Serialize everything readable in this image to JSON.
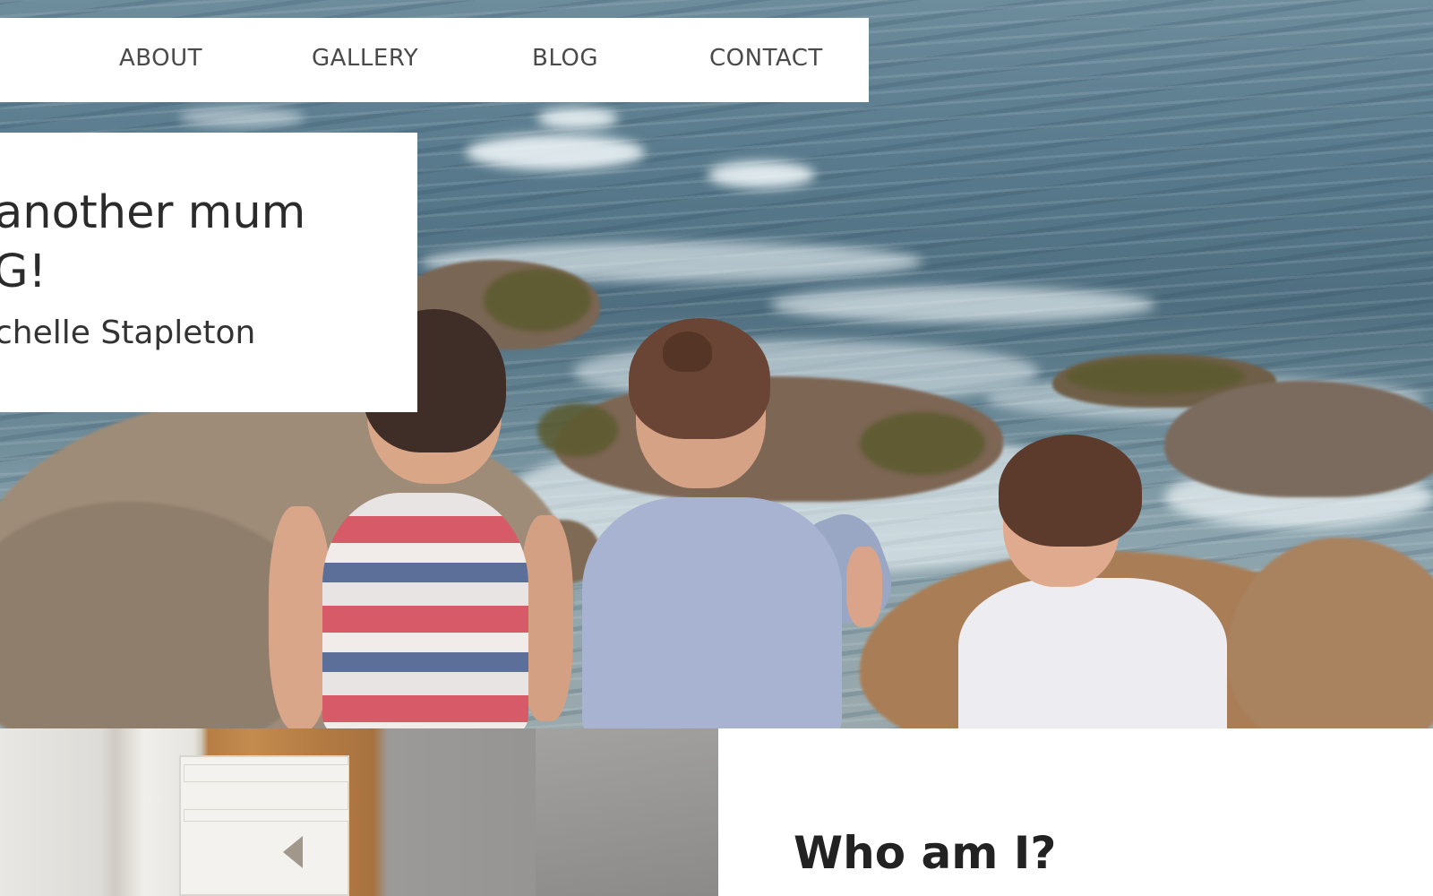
{
  "nav": {
    "items": [
      {
        "label": "ABOUT"
      },
      {
        "label": "GALLERY"
      },
      {
        "label": "BLOG"
      },
      {
        "label": "CONTACT"
      }
    ]
  },
  "hero": {
    "title_line_1": "another mum",
    "title_line_2": "G!",
    "subtitle": "chelle Stapleton"
  },
  "about": {
    "heading": "Who am I?"
  }
}
